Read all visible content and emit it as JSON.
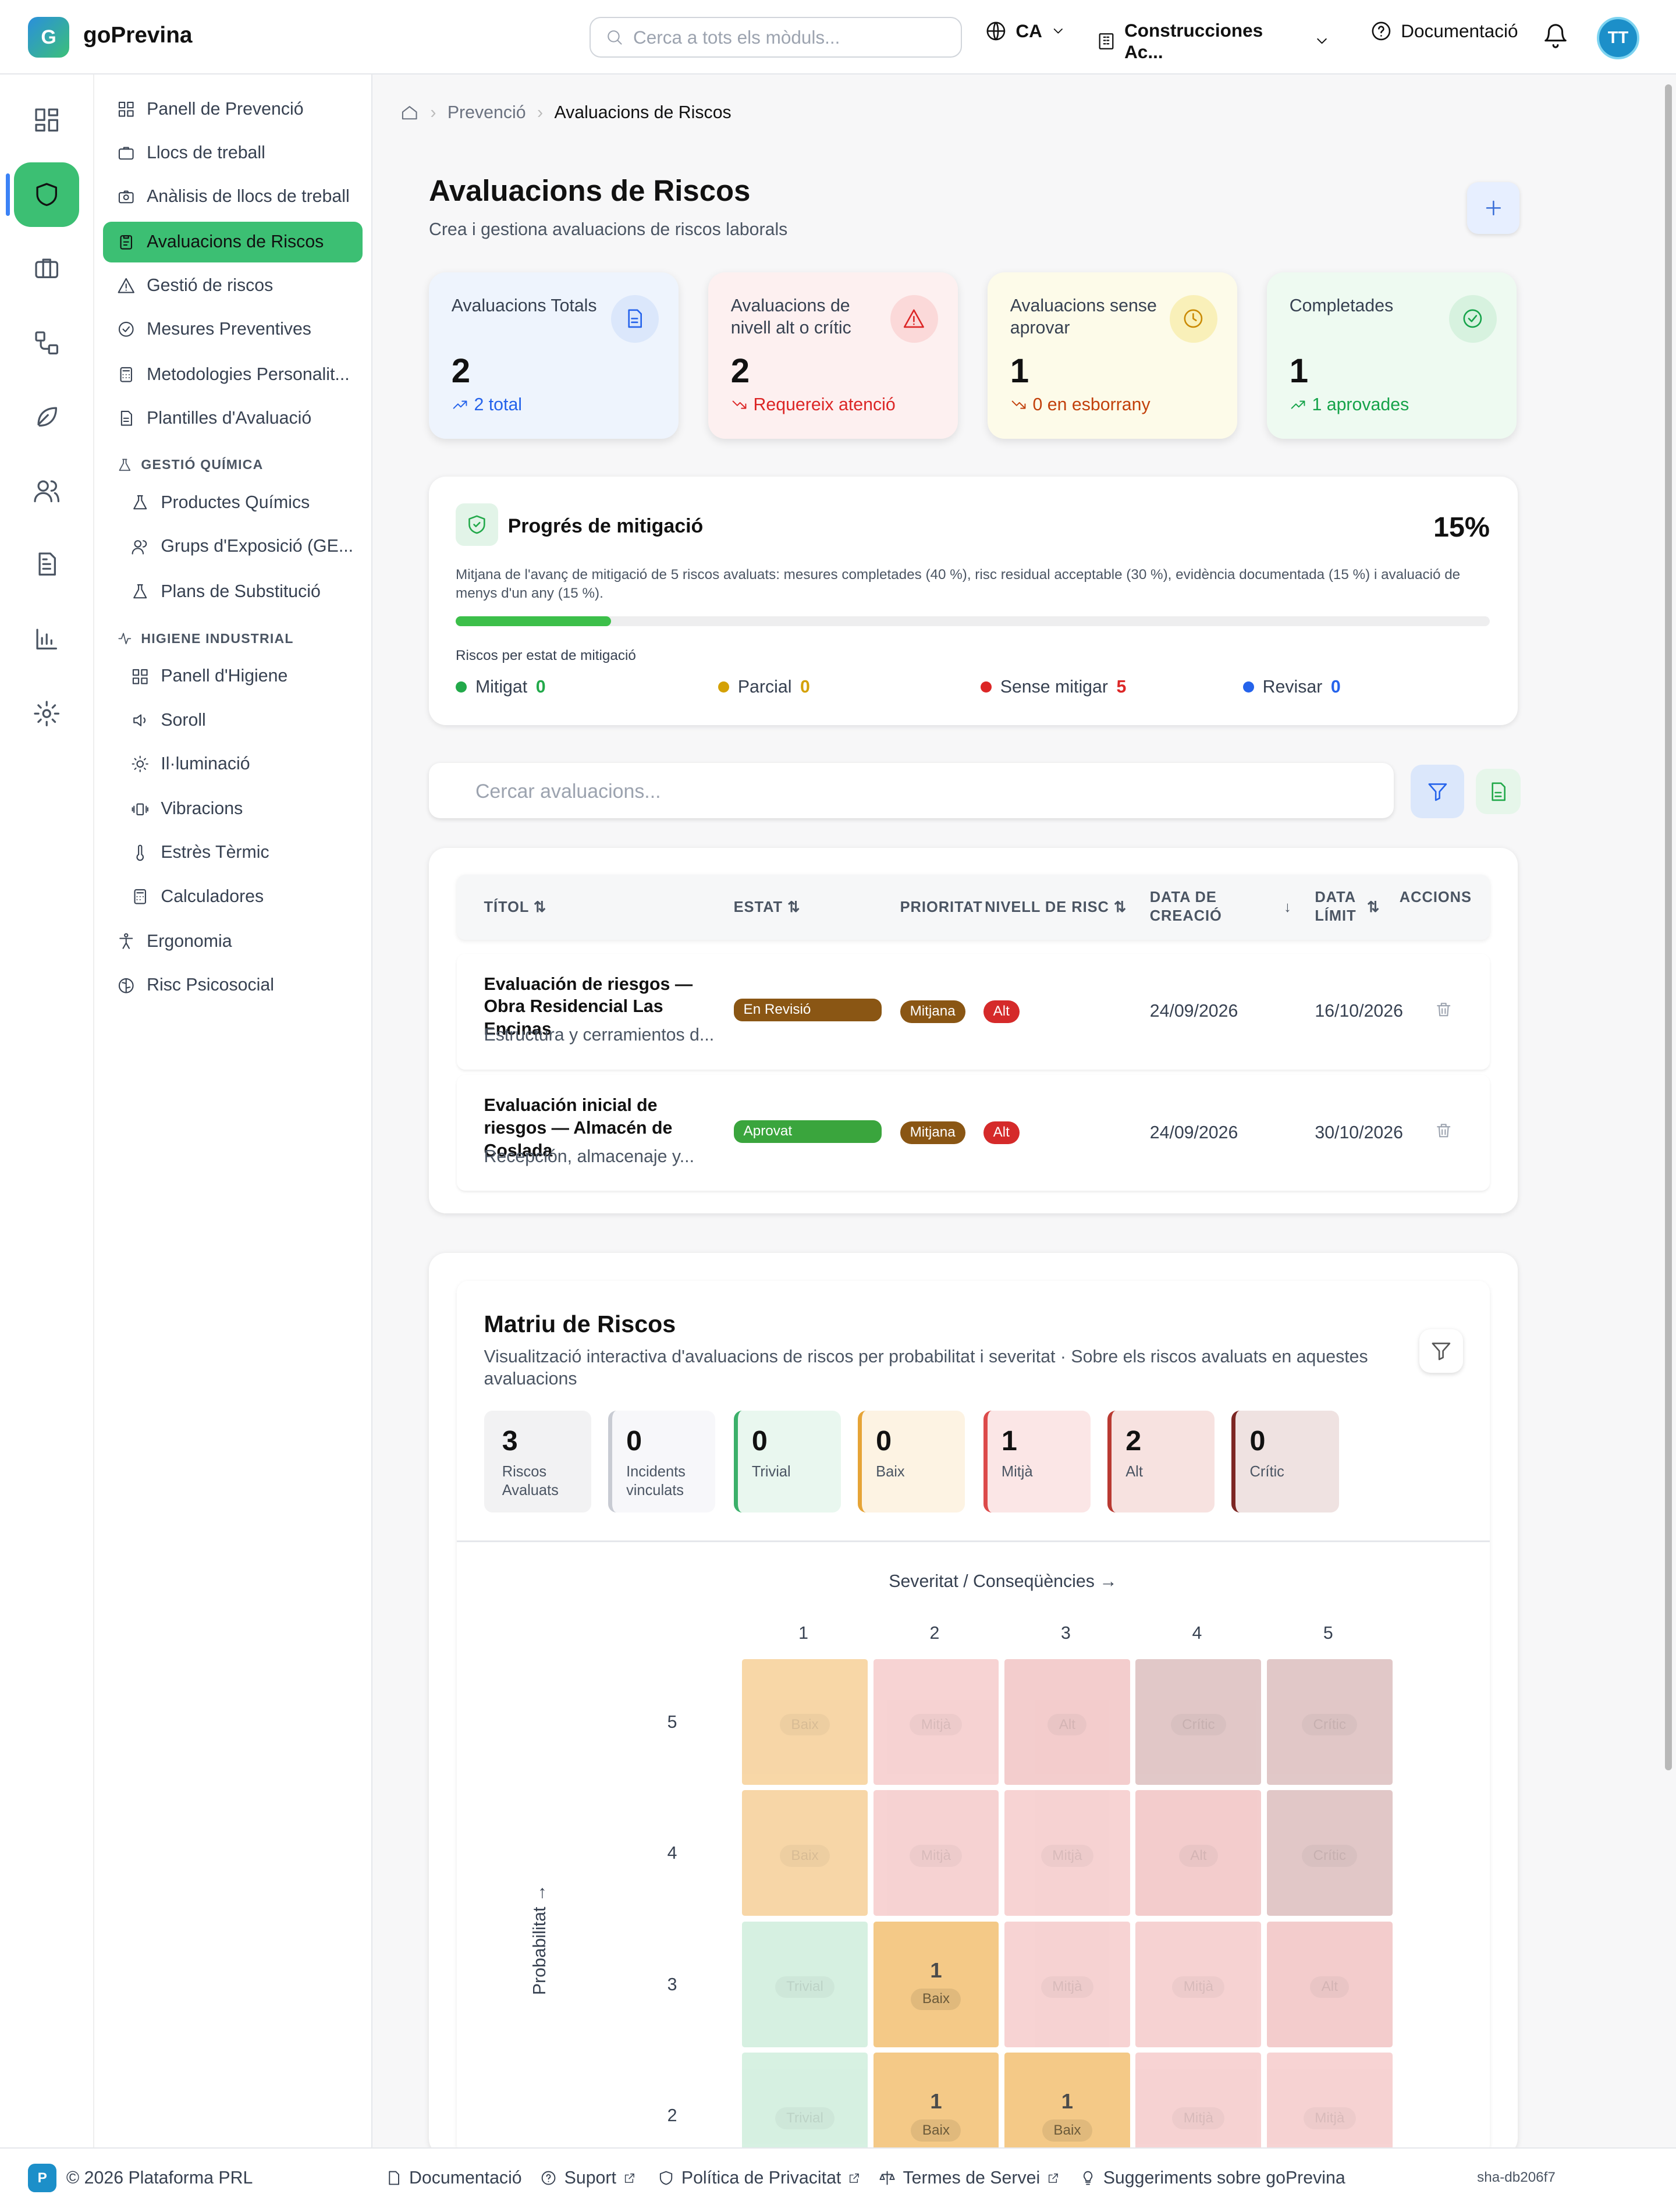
{
  "header": {
    "logo_letter": "G",
    "brand": "goPrevina",
    "search_placeholder": "Cerca a tots els mòduls...",
    "language": "CA",
    "company": "Construcciones Ac...",
    "docs": "Documentació",
    "avatar": "TT"
  },
  "rail": {
    "items": [
      "dashboard-icon",
      "shield-icon",
      "briefcase-icon",
      "workflow-icon",
      "leaf-icon",
      "users-icon",
      "document-icon",
      "chart-icon",
      "gear-icon"
    ],
    "active": 1
  },
  "sidebar": {
    "items": [
      {
        "label": "Panell de Prevenció",
        "icon": "grid"
      },
      {
        "label": "Llocs de treball",
        "icon": "briefcase"
      },
      {
        "label": "Anàlisis de llocs de treball",
        "icon": "camera"
      },
      {
        "label": "Avaluacions de Riscos",
        "icon": "clipboard",
        "active": true
      },
      {
        "label": "Gestió de riscos",
        "icon": "warning"
      },
      {
        "label": "Mesures Preventives",
        "icon": "check-circle"
      },
      {
        "label": "Metodologies Personalit...",
        "icon": "calculator"
      },
      {
        "label": "Plantilles d'Avaluació",
        "icon": "document"
      }
    ],
    "chem_header": "GESTIÓ QUÍMICA",
    "chem_items": [
      "Productes Químics",
      "Grups d'Exposició (GE...",
      "Plans de Substitució"
    ],
    "hyg_header": "HIGIENE INDUSTRIAL",
    "hyg_items": [
      "Panell d'Higiene",
      "Soroll",
      "Il·luminació",
      "Vibracions",
      "Estrès Tèrmic",
      "Calculadores"
    ],
    "bottom_items": [
      "Ergonomia",
      "Risc Psicosocial"
    ]
  },
  "breadcrumb": {
    "parent": "Prevenció",
    "current": "Avaluacions de Riscos"
  },
  "page": {
    "title": "Avaluacions de Riscos",
    "subtitle": "Crea i gestiona avaluacions de riscos laborals"
  },
  "cards": [
    {
      "label": "Avaluacions Totals",
      "value": "2",
      "sub": "2 total",
      "bg": "#eef4fd",
      "sub_color": "#2563eb",
      "icon_bg": "#dbe7fb",
      "icon_color": "#2563eb",
      "trend": "up"
    },
    {
      "label": "Avaluacions de nivell alt o crític",
      "value": "2",
      "sub": "Requereix atenció",
      "bg": "#fdf0f0",
      "sub_color": "#dc2626",
      "icon_bg": "#fbd9d9",
      "icon_color": "#dc2626",
      "trend": "down"
    },
    {
      "label": "Avaluacions sense aprovar",
      "value": "1",
      "sub": "0 en esborrany",
      "bg": "#fdfbe9",
      "sub_color": "#c2410c",
      "icon_bg": "#f9f0b9",
      "icon_color": "#ca8a04",
      "trend": "down"
    },
    {
      "label": "Completades",
      "value": "1",
      "sub": "1 aprovades",
      "bg": "#eefaf1",
      "sub_color": "#16a34a",
      "icon_bg": "#d7f2df",
      "icon_color": "#16a34a",
      "trend": "up"
    }
  ],
  "mitigation": {
    "title": "Progrés de mitigació",
    "percent": "15%",
    "progress": 0.15,
    "desc": "Mitjana de l'avanç de mitigació de 5 riscos avaluats: mesures completades (40 %), risc residual acceptable (30 %), evidència documentada (15 %) i avaluació de menys d'un any (15 %).",
    "legend_title": "Riscos per estat de mitigació",
    "legend": [
      {
        "label": "Mitigat",
        "value": "0",
        "color": "#22a94a"
      },
      {
        "label": "Parcial",
        "value": "0",
        "color": "#d4a106"
      },
      {
        "label": "Sense mitigar",
        "value": "5",
        "color": "#dc2626"
      },
      {
        "label": "Revisar",
        "value": "0",
        "color": "#2563eb"
      }
    ]
  },
  "table_search_placeholder": "Cercar avaluacions...",
  "table": {
    "headers": [
      "TÍTOL",
      "ESTAT",
      "PRIORITAT",
      "NIVELL DE RISC",
      "DATA DE CREACIÓ",
      "DATA LÍMIT",
      "ACCIONS"
    ],
    "rows": [
      {
        "title": "Evaluación de riesgos — Obra Residencial Las Encinas",
        "desc": "Estructura y cerramientos d...",
        "status": "En Revisió",
        "status_color": "#8a5614",
        "priority": "Mitjana",
        "risk": "Alt",
        "created": "24/09/2026",
        "deadline": "16/10/2026"
      },
      {
        "title": "Evaluación inicial de riesgos — Almacén de Coslada",
        "desc": "Recepción, almacenaje y...",
        "status": "Aprovat",
        "status_color": "#3aa53d",
        "priority": "Mitjana",
        "risk": "Alt",
        "created": "24/09/2026",
        "deadline": "30/10/2026"
      }
    ]
  },
  "matrix": {
    "title": "Matriu de Riscos",
    "subtitle": "Visualització interactiva d'avaluacions de riscos per probabilitat i severitat · Sobre els riscos avaluats en aquestes avaluacions",
    "stats": [
      {
        "value": "3",
        "label": "Riscos Avaluats",
        "bg": "#f2f2f3",
        "border": "#f2f2f3"
      },
      {
        "value": "0",
        "label": "Incidents vinculats",
        "bg": "#f7f7fa",
        "border": "#c8cbd3"
      },
      {
        "value": "0",
        "label": "Trivial",
        "bg": "#e9f7ef",
        "border": "#3bb06a"
      },
      {
        "value": "0",
        "label": "Baix",
        "bg": "#fdf3e3",
        "border": "#e6a437"
      },
      {
        "value": "1",
        "label": "Mitjà",
        "bg": "#fbe6e6",
        "border": "#dc4a4a"
      },
      {
        "value": "2",
        "label": "Alt",
        "bg": "#f7e2e0",
        "border": "#b93a32"
      },
      {
        "value": "0",
        "label": "Crític",
        "bg": "#efe2e1",
        "border": "#7c2623"
      }
    ],
    "x_axis": "Severitat / Conseqüències →",
    "y_axis": "Probabilitat →",
    "cols": [
      "1",
      "2",
      "3",
      "4",
      "5"
    ],
    "rows": [
      {
        "p": "5",
        "cells": [
          {
            "t": "Baix"
          },
          {
            "t": "Mitjà"
          },
          {
            "t": "Alt"
          },
          {
            "t": "Crític"
          },
          {
            "t": "Crític"
          }
        ]
      },
      {
        "p": "4",
        "cells": [
          {
            "t": "Baix"
          },
          {
            "t": "Mitjà"
          },
          {
            "t": "Mitjà"
          },
          {
            "t": "Alt"
          },
          {
            "t": "Crític"
          }
        ]
      },
      {
        "p": "3",
        "cells": [
          {
            "t": "Trivial"
          },
          {
            "t": "Baix",
            "n": "1"
          },
          {
            "t": "Mitjà"
          },
          {
            "t": "Mitjà"
          },
          {
            "t": "Alt"
          }
        ]
      },
      {
        "p": "2",
        "cells": [
          {
            "t": "Trivial"
          },
          {
            "t": "Baix",
            "n": "1"
          },
          {
            "t": "Baix",
            "n": "1"
          },
          {
            "t": "Mitjà"
          },
          {
            "t": "Mitjà"
          }
        ]
      }
    ],
    "level_colors": {
      "Trivial": "#c9ecd8",
      "Baix": "#f5c98a",
      "Mitjà": "#f4c4c4",
      "Alt": "#efbcbc",
      "Crític": "#d7b5b5"
    }
  },
  "footer": {
    "logo": "P",
    "copyright": "© 2026 Plataforma PRL",
    "links": [
      "Documentació",
      "Suport",
      "Política de Privacitat",
      "Termes de Servei",
      "Suggeriments sobre goPrevina"
    ],
    "version": "sha-db206f7"
  }
}
